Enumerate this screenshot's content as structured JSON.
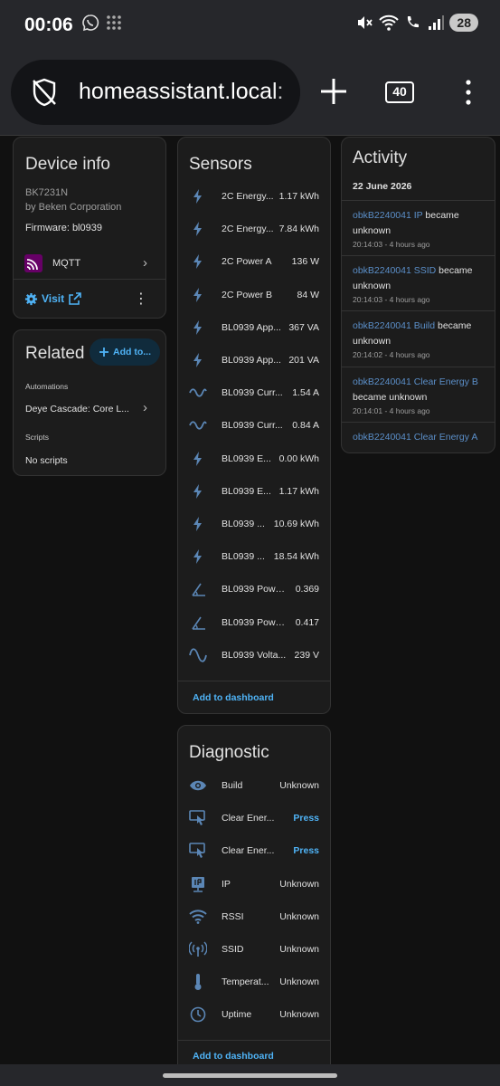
{
  "status_bar": {
    "time": "00:06",
    "battery": "28"
  },
  "browser": {
    "url": "homeassistant.local:",
    "tab_count": "40"
  },
  "device_info": {
    "title": "Device info",
    "model": "BK7231N",
    "manufacturer": "by Beken Corporation",
    "firmware": "Firmware: bl0939",
    "integration": "MQTT",
    "visit_label": "Visit"
  },
  "related": {
    "title": "Related",
    "add_button": "Add to...",
    "automations_heading": "Automations",
    "automation_item": "Deye Cascade: Core L...",
    "scripts_heading": "Scripts",
    "scripts_item": "No scripts"
  },
  "sensors": {
    "title": "Sensors",
    "items": [
      {
        "name": "2C Energy...",
        "value": "1.17 kWh",
        "icon": "flash-icon"
      },
      {
        "name": "2C Energy...",
        "value": "7.84 kWh",
        "icon": "flash-icon"
      },
      {
        "name": "2C Power A",
        "value": "136 W",
        "icon": "flash-icon"
      },
      {
        "name": "2C Power B",
        "value": "84 W",
        "icon": "flash-icon"
      },
      {
        "name": "BL0939 App...",
        "value": "367 VA",
        "icon": "flash-icon"
      },
      {
        "name": "BL0939 App...",
        "value": "201 VA",
        "icon": "flash-icon"
      },
      {
        "name": "BL0939 Curr...",
        "value": "1.54 A",
        "icon": "current-ac-icon"
      },
      {
        "name": "BL0939 Curr...",
        "value": "0.84 A",
        "icon": "current-ac-icon"
      },
      {
        "name": "BL0939 E...",
        "value": "0.00 kWh",
        "icon": "flash-icon"
      },
      {
        "name": "BL0939 E...",
        "value": "1.17 kWh",
        "icon": "flash-icon"
      },
      {
        "name": "BL0939 ...",
        "value": "10.69 kWh",
        "icon": "flash-icon"
      },
      {
        "name": "BL0939 ...",
        "value": "18.54 kWh",
        "icon": "flash-icon"
      },
      {
        "name": "BL0939 Powe...",
        "value": "0.369",
        "icon": "angle-acute-icon"
      },
      {
        "name": "BL0939 Powe...",
        "value": "0.417",
        "icon": "angle-acute-icon"
      },
      {
        "name": "BL0939 Volta...",
        "value": "239 V",
        "icon": "sine-wave-icon"
      }
    ],
    "add_to_dashboard": "Add to dashboard"
  },
  "diagnostic": {
    "title": "Diagnostic",
    "items": [
      {
        "name": "Build",
        "value": "Unknown",
        "icon": "eye-icon"
      },
      {
        "name": "Clear Ener...",
        "value": "Press",
        "icon": "gesture-tap-button-icon"
      },
      {
        "name": "Clear Ener...",
        "value": "Press",
        "icon": "gesture-tap-button-icon"
      },
      {
        "name": "IP",
        "value": "Unknown",
        "icon": "ip-network-icon"
      },
      {
        "name": "RSSI",
        "value": "Unknown",
        "icon": "wifi-icon"
      },
      {
        "name": "SSID",
        "value": "Unknown",
        "icon": "access-point-icon"
      },
      {
        "name": "Temperat...",
        "value": "Unknown",
        "icon": "thermometer-icon"
      },
      {
        "name": "Uptime",
        "value": "Unknown",
        "icon": "clock-icon"
      }
    ],
    "add_to_dashboard": "Add to dashboard"
  },
  "activity": {
    "title": "Activity",
    "date": "22 June 2026",
    "entries": [
      {
        "entity": "obkB2240041 IP",
        "text": "became unknown",
        "time": "20:14:03 - 4 hours ago"
      },
      {
        "entity": "obkB2240041 SSID",
        "text": "became unknown",
        "time": "20:14:03 - 4 hours ago"
      },
      {
        "entity": "obkB2240041 Build",
        "text": "became unknown",
        "time": "20:14:02 - 4 hours ago"
      },
      {
        "entity": "obkB2240041 Clear Energy B",
        "text": "became unknown",
        "time": "20:14:01 - 4 hours ago"
      },
      {
        "entity": "obkB2240041 Clear Energy A",
        "text": "",
        "time": ""
      }
    ]
  },
  "colors": {
    "accent": "#4fb3f6",
    "activity_link": "#5b8fc9",
    "card_bg": "#1c1c1c",
    "page_bg": "#111111"
  }
}
